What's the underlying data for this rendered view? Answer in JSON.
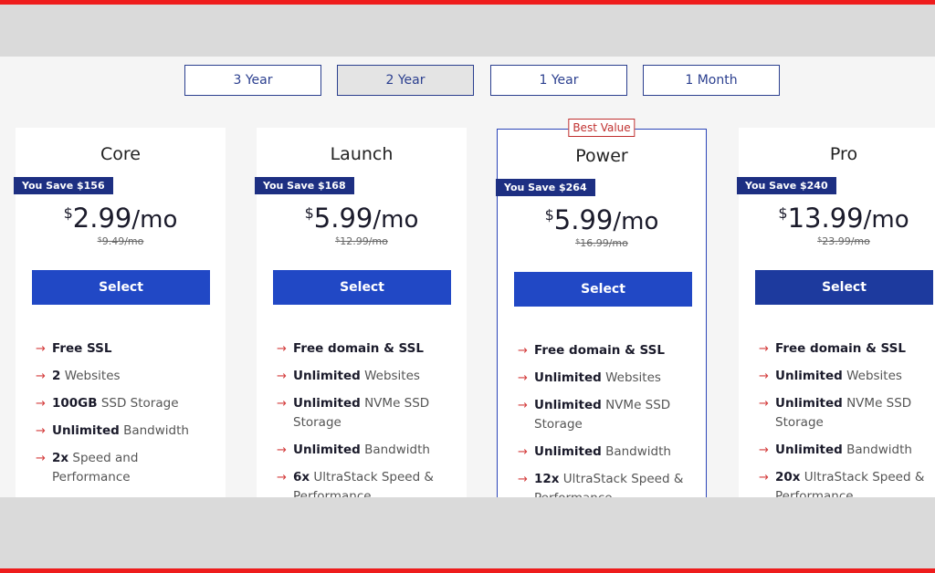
{
  "term_tabs": [
    {
      "label": "3 Year",
      "active": false
    },
    {
      "label": "2 Year",
      "active": true
    },
    {
      "label": "1 Year",
      "active": false
    },
    {
      "label": "1 Month",
      "active": false
    }
  ],
  "plans": [
    {
      "name": "Core",
      "save": "You Save $156",
      "currency": "$",
      "amount": "2.99",
      "per": "/mo",
      "old_currency": "$",
      "old_price": "9.49/mo",
      "select_label": "Select",
      "features": [
        {
          "bold": "Free SSL",
          "rest": ""
        },
        {
          "bold": "2",
          "rest": " Websites"
        },
        {
          "bold": "100GB",
          "rest": " SSD Storage"
        },
        {
          "bold": "Unlimited",
          "rest": " Bandwidth"
        },
        {
          "bold": "2x",
          "rest": " Speed and Performance"
        }
      ]
    },
    {
      "name": "Launch",
      "save": "You Save $168",
      "currency": "$",
      "amount": "5.99",
      "per": "/mo",
      "old_currency": "$",
      "old_price": "12.99/mo",
      "select_label": "Select",
      "features": [
        {
          "bold": "Free domain & SSL",
          "rest": ""
        },
        {
          "bold": "Unlimited",
          "rest": " Websites"
        },
        {
          "bold": "Unlimited",
          "rest": " NVMe SSD Storage"
        },
        {
          "bold": "Unlimited",
          "rest": " Bandwidth"
        },
        {
          "bold": "6x",
          "rest": " UltraStack Speed & Performance"
        }
      ]
    },
    {
      "name": "Power",
      "badge": "Best Value",
      "save": "You Save $264",
      "currency": "$",
      "amount": "5.99",
      "per": "/mo",
      "old_currency": "$",
      "old_price": "16.99/mo",
      "select_label": "Select",
      "features": [
        {
          "bold": "Free domain & SSL",
          "rest": ""
        },
        {
          "bold": "Unlimited",
          "rest": " Websites"
        },
        {
          "bold": "Unlimited",
          "rest": " NVMe SSD Storage"
        },
        {
          "bold": "Unlimited",
          "rest": " Bandwidth"
        },
        {
          "bold": "12x",
          "rest": " UltraStack Speed & Performance"
        }
      ]
    },
    {
      "name": "Pro",
      "save": "You Save $240",
      "currency": "$",
      "amount": "13.99",
      "per": "/mo",
      "old_currency": "$",
      "old_price": "23.99/mo",
      "select_label": "Select",
      "features": [
        {
          "bold": "Free domain & SSL",
          "rest": ""
        },
        {
          "bold": "Unlimited",
          "rest": " Websites"
        },
        {
          "bold": "Unlimited",
          "rest": " NVMe SSD Storage"
        },
        {
          "bold": "Unlimited",
          "rest": " Bandwidth"
        },
        {
          "bold": "20x",
          "rest": " UltraStack Speed & Performance"
        }
      ]
    }
  ],
  "icons": {
    "feature_bullet": "arrow-right-icon"
  },
  "colors": {
    "accent": "#2148c5",
    "badge": "#1d2f82",
    "arrow": "#d43d3d",
    "best_value": "#c0302f",
    "frame": "#ee1c1c"
  }
}
